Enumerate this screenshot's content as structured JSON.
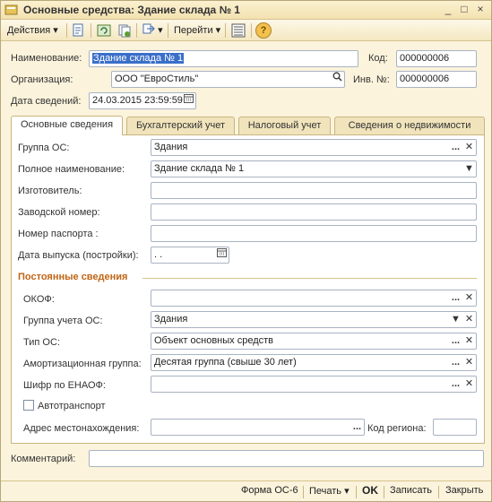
{
  "window": {
    "title": "Основные средства: Здание склада № 1",
    "controls": [
      "_",
      "□",
      "×"
    ]
  },
  "toolbar": {
    "actions_label": "Действия",
    "goto_label": "Перейти",
    "help_symbol": "?"
  },
  "header": {
    "name_label": "Наименование:",
    "name_value": "Здание склада № 1",
    "code_label": "Код:",
    "code_value": "000000006",
    "org_label": "Организация:",
    "org_value": "ООО \"ЕвроСтиль\"",
    "inv_label": "Инв. №:",
    "inv_value": "000000006",
    "date_label": "Дата сведений:",
    "date_value": "24.03.2015 23:59:59"
  },
  "tabs": [
    {
      "label": "Основные сведения"
    },
    {
      "label": "Бухгалтерский учет"
    },
    {
      "label": "Налоговый учет"
    },
    {
      "label": "Сведения о недвижимости"
    }
  ],
  "main": {
    "group_os_label": "Группа ОС:",
    "group_os_value": "Здания",
    "full_name_label": "Полное наименование:",
    "full_name_value": "Здание склада № 1",
    "manufacturer_label": "Изготовитель:",
    "manufacturer_value": "",
    "serial_label": "Заводской номер:",
    "serial_value": "",
    "passport_label": "Номер паспорта :",
    "passport_value": "",
    "release_date_label": "Дата выпуска (постройки):",
    "release_date_value": " .  .",
    "permanent_title": "Постоянные сведения",
    "okof_label": "ОКОФ:",
    "okof_value": "",
    "accounting_group_label": "Группа учета ОС:",
    "accounting_group_value": "Здания",
    "type_label": "Тип ОС:",
    "type_value": "Объект основных средств",
    "amort_group_label": "Амортизационная группа:",
    "amort_group_value": "Десятая группа (свыше 30 лет)",
    "enaof_label": "Шифр по ЕНАОФ:",
    "enaof_value": "",
    "autotransport_label": "Автотранспорт",
    "address_label": "Адрес местонахождения:",
    "address_value": "",
    "region_label": "Код региона:",
    "region_value": ""
  },
  "comment": {
    "label": "Комментарий:",
    "value": ""
  },
  "footer": {
    "form_label": "Форма ОС-6",
    "print_label": "Печать",
    "ok_label": "OK",
    "save_label": "Записать",
    "close_label": "Закрыть"
  },
  "colors": {
    "window_bg": "#fbf3dc",
    "section_title": "#c06515",
    "selection": "#3a6fc9"
  }
}
